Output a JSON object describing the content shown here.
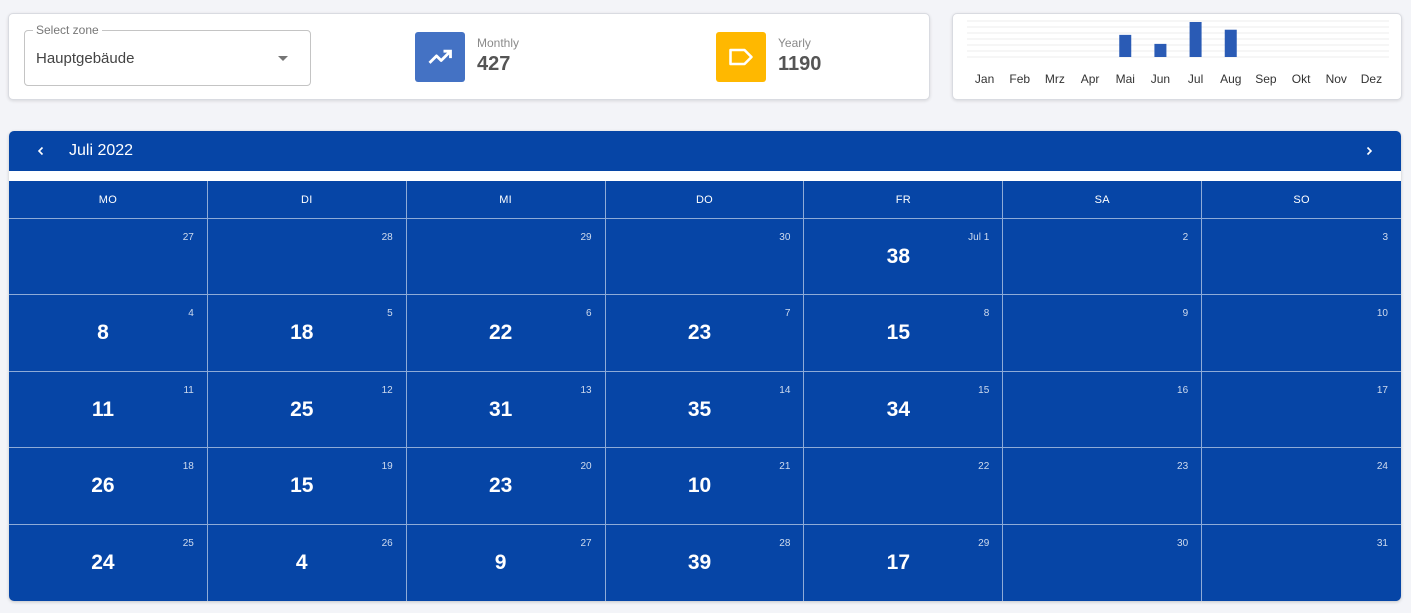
{
  "zone": {
    "label": "Select zone",
    "value": "Hauptgebäude"
  },
  "stats": {
    "monthly": {
      "label": "Monthly",
      "value": "427",
      "color": "#4472c4",
      "icon": "trending-up-icon"
    },
    "yearly": {
      "label": "Yearly",
      "value": "1190",
      "color": "#ffb800",
      "icon": "label-tag-icon"
    }
  },
  "chart_data": {
    "type": "bar",
    "categories": [
      "Jan",
      "Feb",
      "Mrz",
      "Apr",
      "Mai",
      "Jun",
      "Jul",
      "Aug",
      "Sep",
      "Okt",
      "Nov",
      "Dez"
    ],
    "values": [
      0,
      0,
      0,
      0,
      270,
      160,
      427,
      333,
      0,
      0,
      0,
      0
    ],
    "color": "#2a5bb5",
    "grid": true
  },
  "calendar": {
    "title": "Juli 2022",
    "weekdays": [
      "MO",
      "DI",
      "MI",
      "DO",
      "FR",
      "SA",
      "SO"
    ],
    "color": "#0645a6",
    "days": [
      {
        "d": "27",
        "v": ""
      },
      {
        "d": "28",
        "v": ""
      },
      {
        "d": "29",
        "v": ""
      },
      {
        "d": "30",
        "v": ""
      },
      {
        "d": "Jul 1",
        "v": "38"
      },
      {
        "d": "2",
        "v": ""
      },
      {
        "d": "3",
        "v": ""
      },
      {
        "d": "4",
        "v": "8"
      },
      {
        "d": "5",
        "v": "18"
      },
      {
        "d": "6",
        "v": "22"
      },
      {
        "d": "7",
        "v": "23"
      },
      {
        "d": "8",
        "v": "15"
      },
      {
        "d": "9",
        "v": ""
      },
      {
        "d": "10",
        "v": ""
      },
      {
        "d": "11",
        "v": "11"
      },
      {
        "d": "12",
        "v": "25"
      },
      {
        "d": "13",
        "v": "31"
      },
      {
        "d": "14",
        "v": "35"
      },
      {
        "d": "15",
        "v": "34"
      },
      {
        "d": "16",
        "v": ""
      },
      {
        "d": "17",
        "v": ""
      },
      {
        "d": "18",
        "v": "26"
      },
      {
        "d": "19",
        "v": "15"
      },
      {
        "d": "20",
        "v": "23"
      },
      {
        "d": "21",
        "v": "10"
      },
      {
        "d": "22",
        "v": ""
      },
      {
        "d": "23",
        "v": ""
      },
      {
        "d": "24",
        "v": ""
      },
      {
        "d": "25",
        "v": "24"
      },
      {
        "d": "26",
        "v": "4"
      },
      {
        "d": "27",
        "v": "9"
      },
      {
        "d": "28",
        "v": "39"
      },
      {
        "d": "29",
        "v": "17"
      },
      {
        "d": "30",
        "v": ""
      },
      {
        "d": "31",
        "v": ""
      }
    ]
  }
}
